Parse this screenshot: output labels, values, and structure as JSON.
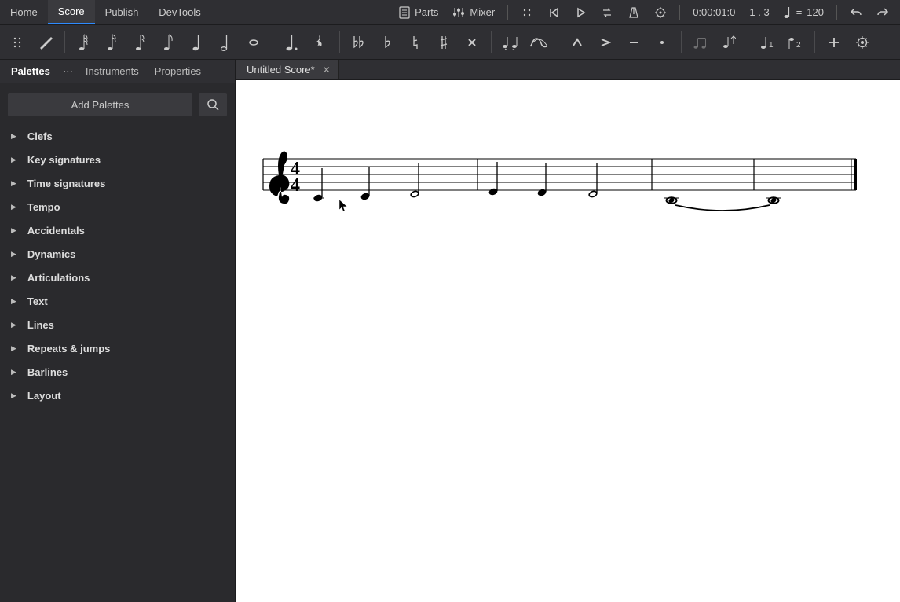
{
  "menu": {
    "items": [
      "Home",
      "Score",
      "Publish",
      "DevTools"
    ],
    "active": "Score"
  },
  "header_right": {
    "parts_label": "Parts",
    "mixer_label": "Mixer",
    "time_position": "0:00:01:0",
    "beat_position": "1 . 3",
    "tempo_prefix": "= ",
    "tempo_value": "120"
  },
  "toolbar": {
    "groups": [
      [
        "drag-handle",
        "pencil"
      ],
      [
        "note-64th",
        "note-32nd",
        "note-16th",
        "note-8th",
        "note-quarter",
        "note-half",
        "note-whole"
      ],
      [
        "note-dotted",
        "rest"
      ],
      [
        "double-flat",
        "flat",
        "natural",
        "sharp",
        "double-sharp"
      ],
      [
        "tie",
        "slur"
      ],
      [
        "marcato",
        "accent",
        "tenuto",
        "staccato"
      ],
      [
        "tuplet",
        "flip-stem"
      ],
      [
        "voice-1",
        "voice-2"
      ],
      [
        "add",
        "settings-gear"
      ]
    ]
  },
  "sidebar": {
    "tabs": [
      "Palettes",
      "Instruments",
      "Properties"
    ],
    "active_tab": "Palettes",
    "add_palettes_label": "Add Palettes",
    "palettes": [
      "Clefs",
      "Key signatures",
      "Time signatures",
      "Tempo",
      "Accidentals",
      "Dynamics",
      "Articulations",
      "Text",
      "Lines",
      "Repeats & jumps",
      "Barlines",
      "Layout"
    ]
  },
  "document": {
    "tab_title": "Untitled Score*"
  },
  "score": {
    "clef": "treble",
    "time_signature": "4/4",
    "measures": 4,
    "notes_description": "m1: two quarter notes + half note; m2: two quarter notes + half note; m3-4: two tied whole notes"
  }
}
